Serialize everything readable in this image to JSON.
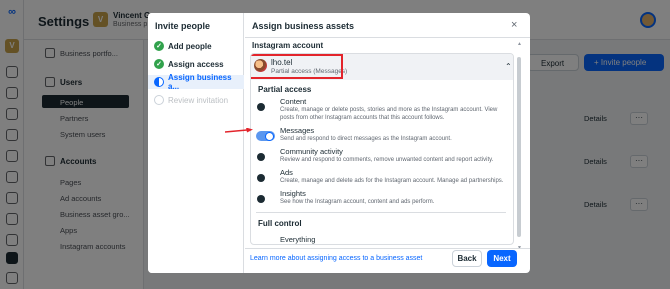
{
  "app": {
    "title": "Settings",
    "account_initial": "V",
    "account_name": "Vincent G",
    "account_sub": "Business p",
    "sidebar": {
      "portfolio": "Business portfo...",
      "users_header": "Users",
      "users_items": [
        "People",
        "Partners",
        "System users"
      ],
      "accounts_header": "Accounts",
      "accounts_items": [
        "Pages",
        "Ad accounts",
        "Business asset gro...",
        "Apps",
        "Instagram accounts"
      ]
    },
    "export_label": "Export",
    "invite_label": "+ Invite people",
    "details_label": "Details",
    "more_label": "···"
  },
  "modal": {
    "steps_title": "Invite people",
    "steps": [
      {
        "label": "Add people",
        "state": "done"
      },
      {
        "label": "Assign access",
        "state": "done"
      },
      {
        "label": "Assign business a...",
        "state": "current"
      },
      {
        "label": "Review invitation",
        "state": "todo"
      }
    ],
    "title": "Assign business assets",
    "close": "×",
    "section_label": "Instagram account",
    "account": {
      "name": "lho.tel",
      "subtitle": "Partial access (Messages)"
    },
    "partial_access_label": "Partial access",
    "permissions": [
      {
        "name": "Content",
        "desc": "Create, manage or delete posts, stories and more as the Instagram account. View posts from other Instagram accounts that this account follows.",
        "on": false
      },
      {
        "name": "Messages",
        "desc": "Send and respond to direct messages as the Instagram account.",
        "on": true
      },
      {
        "name": "Community activity",
        "desc": "Review and respond to comments, remove unwanted content and report activity.",
        "on": false
      },
      {
        "name": "Ads",
        "desc": "Create, manage and delete ads for the Instagram account. Manage ad partnerships.",
        "on": false
      },
      {
        "name": "Insights",
        "desc": "See how the Instagram account, content and ads perform.",
        "on": false
      }
    ],
    "full_control_label": "Full control",
    "everything_label": "Everything",
    "learn_link": "Learn more about assigning access to a business asset",
    "back_label": "Back",
    "next_label": "Next"
  },
  "colors": {
    "accent": "#0866ff",
    "highlight": "#e3242b",
    "done": "#31a24c"
  }
}
